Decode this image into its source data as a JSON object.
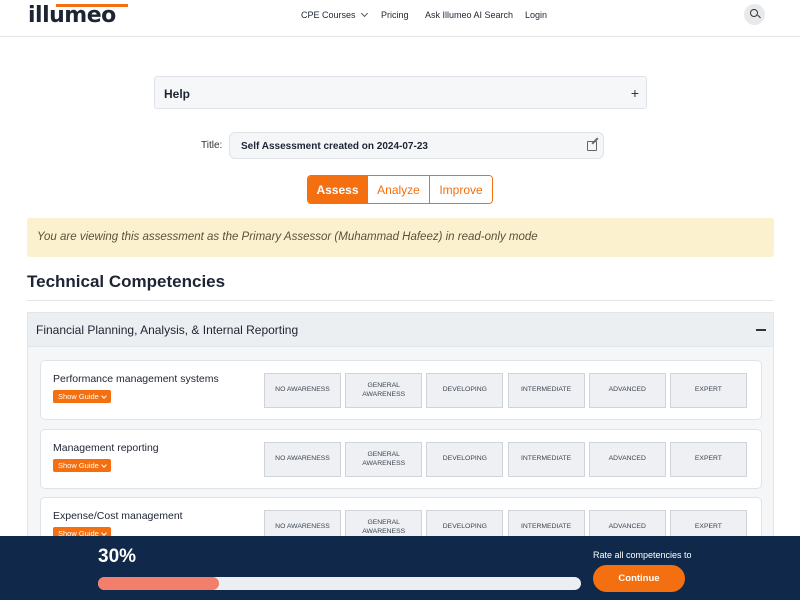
{
  "brand": {
    "logo_text": "illumeo",
    "accent": "#f36f0f",
    "navy": "#10284a"
  },
  "nav": {
    "cpe_courses": "CPE Courses",
    "pricing": "Pricing",
    "ask_ai": "Ask Illumeo AI Search",
    "login": "Login",
    "search_icon": "search-icon"
  },
  "help": {
    "title": "Help",
    "toggle": "+"
  },
  "assessment": {
    "title_label": "Title:",
    "title_value": "Self Assessment created on 2024-07-23"
  },
  "tabs": [
    {
      "label": "Assess",
      "active": true
    },
    {
      "label": "Analyze",
      "active": false
    },
    {
      "label": "Improve",
      "active": false
    }
  ],
  "notice": "You are viewing this assessment as the Primary Assessor (Muhammad Hafeez) in read-only mode",
  "section_heading": "Technical Competencies",
  "category": {
    "title": "Financial Planning, Analysis, & Internal Reporting"
  },
  "show_guide_label": "Show Guide",
  "levels": [
    "NO AWARENESS",
    "GENERAL AWARENESS",
    "DEVELOPING",
    "INTERMEDIATE",
    "ADVANCED",
    "EXPERT"
  ],
  "competencies": [
    {
      "name": "Performance management systems"
    },
    {
      "name": "Management reporting"
    },
    {
      "name": "Expense/Cost management"
    }
  ],
  "progress": {
    "percent_label": "30%",
    "percent": 0.25,
    "rate_text": "Rate all competencies to",
    "continue_label": "Continue"
  }
}
